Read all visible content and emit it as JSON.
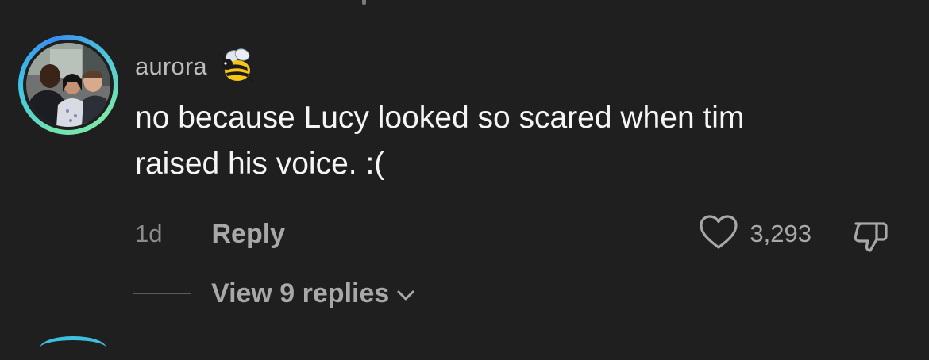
{
  "comment": {
    "username": "aurora",
    "username_emoji": "bee-icon",
    "text": "no because Lucy looked so scared when tim\nraised his voice. :(",
    "timestamp": "1d",
    "reply_label": "Reply",
    "like_count": "3,293",
    "view_replies_label": "View 9 replies"
  },
  "icons": {
    "avatar": "avatar-photo",
    "like": "heart-outline-icon",
    "dislike": "thumbs-down-icon",
    "expand": "chevron-down-icon"
  },
  "colors": {
    "background": "#1f1f1f",
    "primary_text": "#f5f5f5",
    "secondary_text": "#a8a8a8",
    "ring_gradient": [
      "#6fe3b0",
      "#3ec3e8",
      "#3a8ef0"
    ]
  }
}
